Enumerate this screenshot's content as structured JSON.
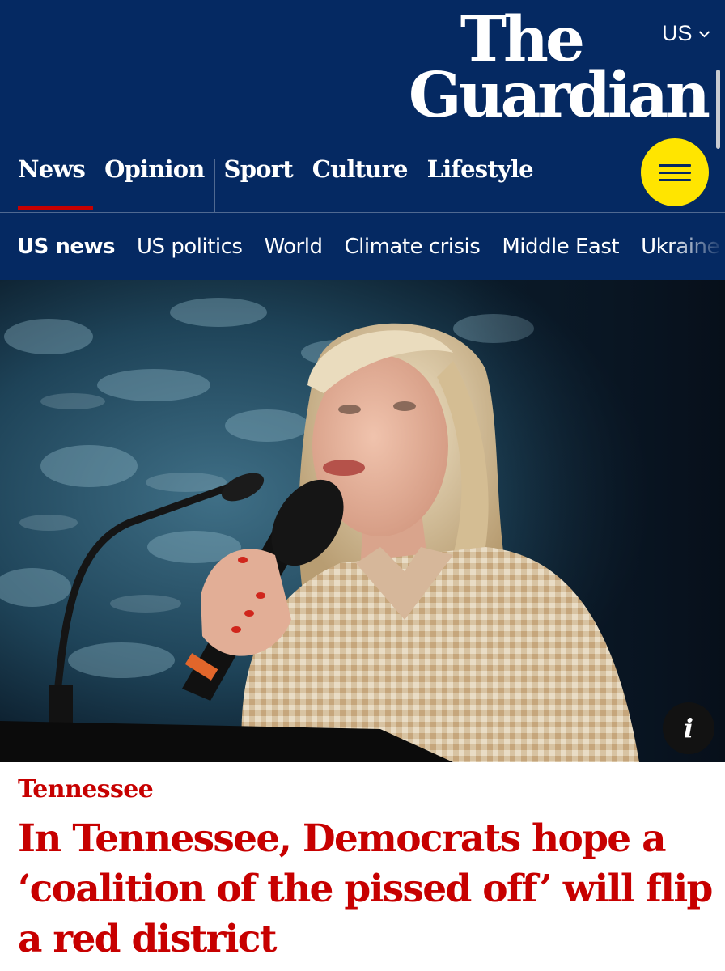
{
  "header": {
    "edition_label": "US",
    "logo_line1": "The",
    "logo_line2": "Guardian"
  },
  "pillars": [
    {
      "label": "News",
      "active": true
    },
    {
      "label": "Opinion"
    },
    {
      "label": "Sport"
    },
    {
      "label": "Culture"
    },
    {
      "label": "Lifestyle"
    }
  ],
  "subnav": [
    {
      "label": "US news",
      "current": true
    },
    {
      "label": "US politics"
    },
    {
      "label": "World"
    },
    {
      "label": "Climate crisis"
    },
    {
      "label": "Middle East"
    },
    {
      "label": "Ukraine"
    }
  ],
  "hero": {
    "info_label": "i"
  },
  "article": {
    "kicker": "Tennessee",
    "headline": "In Tennessee, Democrats hope a ‘coalition of the pissed off’ will flip a red district"
  },
  "icons": {
    "edition": "chevron-down-icon",
    "menu": "hamburger-menu-icon",
    "info": "info-icon"
  },
  "colors": {
    "brand_blue": "#052962",
    "news_red": "#c70000",
    "menu_yellow": "#ffe500",
    "active_underline": "#c70000"
  }
}
